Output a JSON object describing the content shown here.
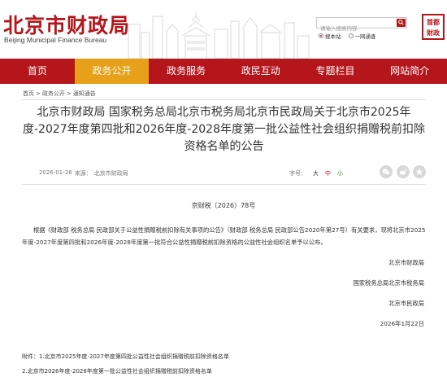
{
  "header": {
    "logo_cn": "北京市财政局",
    "logo_en": "Beijing Municipal Finance Bureau",
    "search_placeholder": "请输入搜索内容",
    "radio_site": "搜本站",
    "radio_network": "一网通查",
    "seal_text": "首都财政"
  },
  "nav": {
    "items": [
      "首页",
      "政务公开",
      "政务服务",
      "政民互动",
      "专题栏目",
      "网站简介"
    ],
    "active_index": 1,
    "active_color": "#e7a019",
    "bar_color": "#b4161c"
  },
  "breadcrumb": {
    "items": [
      "首页",
      "政务公开",
      "通知通告"
    ],
    "separator": ">"
  },
  "article": {
    "title": "北京市财政局 国家税务总局北京市税务局北京市民政局关于北京市2025年度-2027年度第四批和2026年度-2028年度第一批公益性社会组织捐赠税前扣除资格名单的公告",
    "date": "2026-01-26",
    "source_label": "来源：",
    "source": "北京市财政局",
    "fontsize_label": "字号：",
    "fontsize_large": "大",
    "fontsize_medium": "中",
    "fontsize_small": "小",
    "doc_number": "京财税〔2026〕78号",
    "body": "根据《财政部 税务总局 民政部关于公益性捐赠税前扣除有关事项的公告》（财政部 税务总局 民政部公告2020年第27号）有关要求，现将北京市2025年度-2027年度第四批和2026年度-2028年度第一批符合公益性捐赠税前扣除资格的公益性社会组织名单予以公布。",
    "signatures": [
      "北京市财政局",
      "国家税务总局北京市税务局",
      "北京市民政局"
    ],
    "sign_date": "2026年1月22日",
    "attachments": [
      "附件：1.北京市2025年度-2027年度第四批公益性社会组织捐赠税前扣除资格名单",
      "2.北京市2026年度-2028年度第一批公益性社会组织捐赠税前扣除资格名单"
    ]
  }
}
